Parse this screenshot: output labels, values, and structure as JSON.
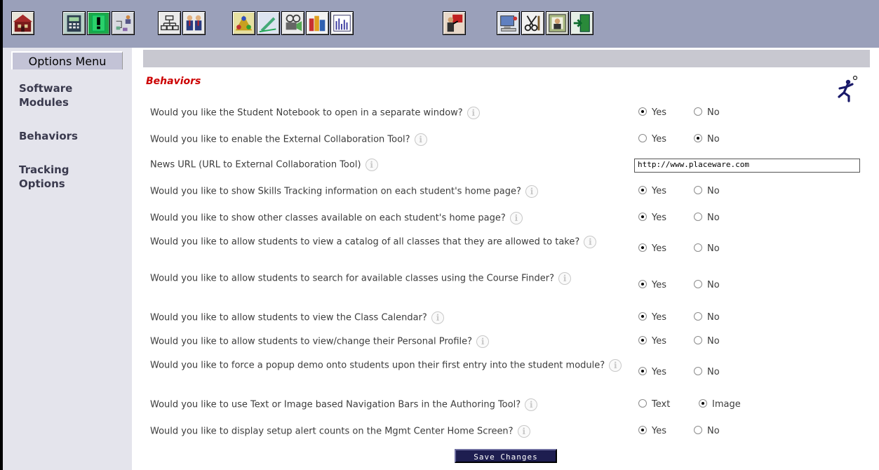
{
  "toolbar": {
    "buttons": [
      {
        "icon": "home-icon"
      },
      {
        "icon": "calculator-icon"
      },
      {
        "icon": "alert-icon"
      },
      {
        "icon": "org-chart-icon"
      },
      {
        "icon": "hierarchy-icon"
      },
      {
        "icon": "people-icon"
      },
      {
        "icon": "group-icon"
      },
      {
        "icon": "pen-icon"
      },
      {
        "icon": "projector-icon"
      },
      {
        "icon": "books-icon"
      },
      {
        "icon": "graph-icon"
      },
      {
        "icon": "presenter-icon"
      },
      {
        "icon": "computer-icon"
      },
      {
        "icon": "tools-icon"
      },
      {
        "icon": "person-frame-icon"
      },
      {
        "icon": "exit-door-icon"
      }
    ]
  },
  "sidebar": {
    "header": "Options Menu",
    "items": [
      {
        "label": "Software Modules"
      },
      {
        "label": "Behaviors"
      },
      {
        "label": "Tracking Options"
      }
    ]
  },
  "main": {
    "section_title": "Behaviors",
    "news_url_value": "http://www.placeware.com",
    "save_label": "Save Changes",
    "questions": [
      {
        "text": "Would you like the Student Notebook to open in a separate window?",
        "options": [
          "Yes",
          "No"
        ],
        "selected": "Yes"
      },
      {
        "text": "Would you like to enable the External Collaboration Tool?",
        "options": [
          "Yes",
          "No"
        ],
        "selected": "No"
      },
      {
        "text": "News URL (URL to External Collaboration Tool)"
      },
      {
        "text": "Would you like to show Skills Tracking information on each student's home page?",
        "options": [
          "Yes",
          "No"
        ],
        "selected": "Yes"
      },
      {
        "text": "Would you like to show other classes available on each student's home page?",
        "options": [
          "Yes",
          "No"
        ],
        "selected": "Yes"
      },
      {
        "text": "Would you like to allow students to view a catalog of all classes that they are allowed to take?",
        "options": [
          "Yes",
          "No"
        ],
        "selected": "Yes"
      },
      {
        "text": "Would you like to allow students to search for available classes using the Course Finder?",
        "options": [
          "Yes",
          "No"
        ],
        "selected": "Yes"
      },
      {
        "text": "Would you like to allow students to view the Class Calendar?",
        "options": [
          "Yes",
          "No"
        ],
        "selected": "Yes"
      },
      {
        "text": "Would you like to allow students to view/change their Personal Profile?",
        "options": [
          "Yes",
          "No"
        ],
        "selected": "Yes"
      },
      {
        "text": "Would you like to force a popup demo onto students upon their first entry into the student module?",
        "options": [
          "Yes",
          "No"
        ],
        "selected": "Yes"
      },
      {
        "text": "Would you like to use Text or Image based Navigation Bars in the Authoring Tool?",
        "options": [
          "Text",
          "Image"
        ],
        "selected": "Image"
      },
      {
        "text": "Would you like to display setup alert counts on the Mgmt Center Home Screen?",
        "options": [
          "Yes",
          "No"
        ],
        "selected": "Yes"
      }
    ]
  }
}
